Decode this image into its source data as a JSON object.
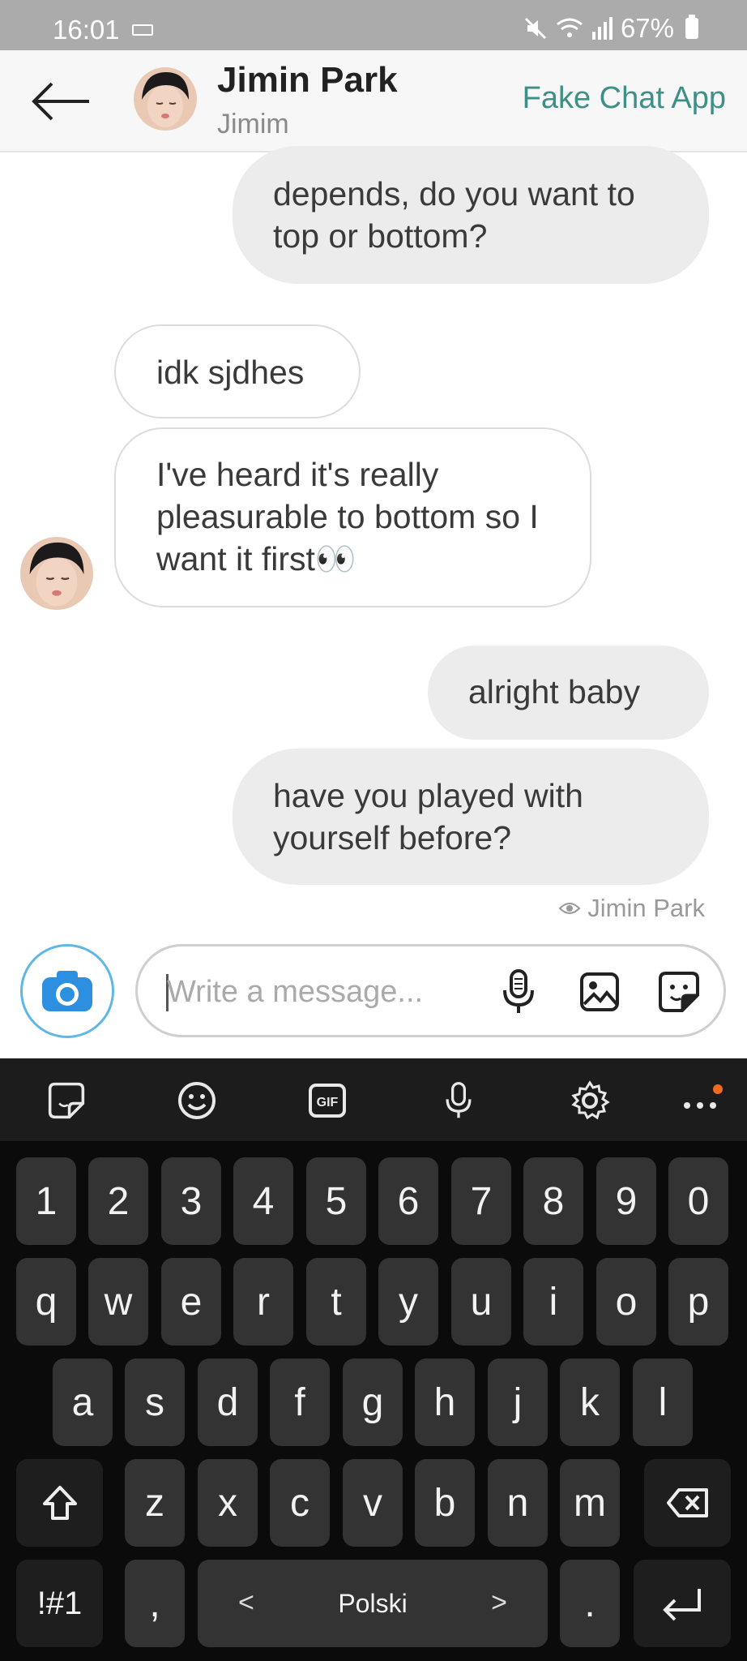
{
  "status": {
    "time": "16:01",
    "battery": "67%"
  },
  "header": {
    "name": "Jimin Park",
    "subtitle": "Jimim",
    "app_name": "Fake Chat App"
  },
  "messages": [
    {
      "side": "out",
      "text": "depends, do you want to top or bottom?"
    },
    {
      "side": "in",
      "text": "idk sjdhes"
    },
    {
      "side": "in",
      "text": "I've heard it's really pleasurable to bottom so I want it first👀"
    },
    {
      "side": "out",
      "text": "alright baby"
    },
    {
      "side": "out",
      "text": "have you played with yourself before?"
    }
  ],
  "seen_by": "Jimin Park",
  "composer": {
    "placeholder": "Write a message..."
  },
  "keyboard": {
    "toolbar": [
      "sticker-icon",
      "emoji-icon",
      "GIF",
      "mic-icon",
      "settings-icon",
      "more-icon"
    ],
    "rows": [
      [
        "1",
        "2",
        "3",
        "4",
        "5",
        "6",
        "7",
        "8",
        "9",
        "0"
      ],
      [
        "q",
        "w",
        "e",
        "r",
        "t",
        "y",
        "u",
        "i",
        "o",
        "p"
      ],
      [
        "a",
        "s",
        "d",
        "f",
        "g",
        "h",
        "j",
        "k",
        "l"
      ],
      [
        "z",
        "x",
        "c",
        "v",
        "b",
        "n",
        "m"
      ]
    ],
    "symbols_label": "!#1",
    "comma": ",",
    "space_label": "Polski",
    "lang_prev": "<",
    "lang_next": ">",
    "period": "."
  },
  "colors": {
    "accent": "#3e8f86",
    "camera": "#2d8fe0",
    "notification_dot": "#f26b1d"
  }
}
